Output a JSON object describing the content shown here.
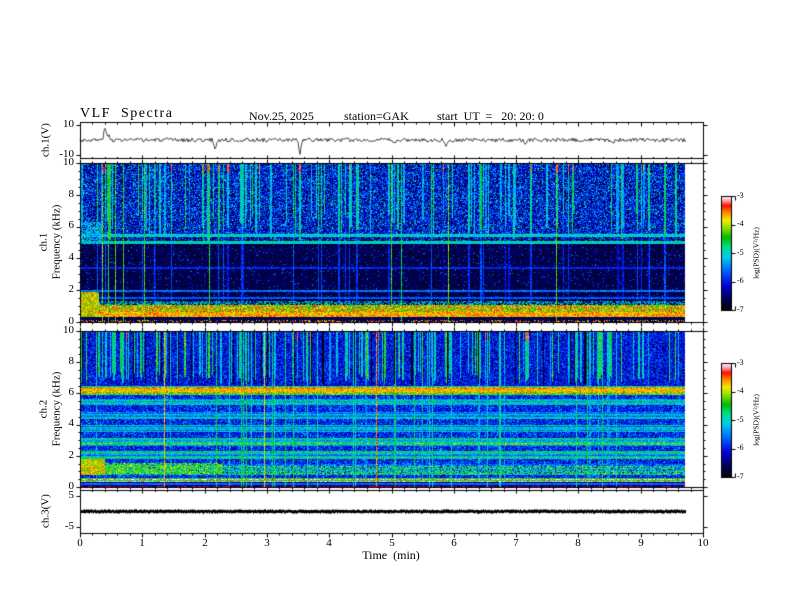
{
  "header": {
    "title": "VLF  Spectra",
    "date": "Nov.25, 2025",
    "station": "station=GAK",
    "start_ut": "start  UT  =   20: 20: 0"
  },
  "xaxis": {
    "label": "Time  (min)",
    "ticks": [
      "0",
      "1",
      "2",
      "3",
      "4",
      "5",
      "6",
      "7",
      "8",
      "9",
      "10"
    ],
    "range": [
      0,
      10
    ],
    "minor_step_min": 0.2,
    "data_end_min": 9.7
  },
  "colorbars": [
    {
      "label": "log(PSD)(V²/Hz)",
      "ticks": [
        "-3",
        "-4",
        "-5",
        "-6",
        "-7"
      ]
    },
    {
      "label": "log(PSD)(V²/Hz)",
      "ticks": [
        "-3",
        "-4",
        "-5",
        "-6",
        "-7"
      ]
    }
  ],
  "chart_data": {
    "colormap": {
      "range": [
        -7,
        -3
      ],
      "stops": [
        {
          "p": 0.0,
          "c": "#000000"
        },
        {
          "p": 0.1,
          "c": "#000055"
        },
        {
          "p": 0.22,
          "c": "#0000dd"
        },
        {
          "p": 0.35,
          "c": "#0066ff"
        },
        {
          "p": 0.47,
          "c": "#00ccee"
        },
        {
          "p": 0.56,
          "c": "#00dd88"
        },
        {
          "p": 0.64,
          "c": "#00bb00"
        },
        {
          "p": 0.72,
          "c": "#88dd00"
        },
        {
          "p": 0.79,
          "c": "#eeee00"
        },
        {
          "p": 0.86,
          "c": "#ff8800"
        },
        {
          "p": 0.92,
          "c": "#ff1100"
        },
        {
          "p": 0.96,
          "c": "#ff99aa"
        },
        {
          "p": 1.0,
          "c": "#ffffff"
        }
      ]
    },
    "panels": [
      {
        "type": "line",
        "name": "ch1-voltage",
        "ylabel": "ch.1(V)",
        "ytick_labels": [
          "10",
          "-10"
        ],
        "yticks_v": [
          10,
          -10
        ],
        "ylim": [
          -12,
          12
        ],
        "seed": 3,
        "noise_v": 1.3,
        "spikes": [
          {
            "t": 0.4,
            "v": 8.5
          },
          {
            "t": 0.46,
            "v": 3.5
          },
          {
            "t": 2.17,
            "v": -6.5
          },
          {
            "t": 3.53,
            "v": -9.5
          },
          {
            "t": 5.05,
            "v": -3.0
          },
          {
            "t": 5.88,
            "v": -4.0
          },
          {
            "t": 7.15,
            "v": -3.2
          },
          {
            "t": 8.55,
            "v": -2.5
          }
        ]
      },
      {
        "type": "heatmap",
        "name": "ch1-spectrogram",
        "ylabel_channel": "ch.1",
        "ylabel_axis": "Frequency  (kHz)",
        "ytick_labels": [
          "10",
          "8",
          "6",
          "4",
          "2",
          "0"
        ],
        "yticks_khz": [
          10,
          8,
          6,
          4,
          2,
          0
        ],
        "ylim_khz": [
          0,
          10
        ],
        "seed": 7,
        "features": [
          {
            "type": "fill",
            "v": 0.03,
            "a": 0.1
          },
          {
            "type": "band",
            "f0": 5.55,
            "f1": 10,
            "v": 0.06,
            "a": 0.3,
            "p": 0.9
          },
          {
            "type": "band",
            "f0": 5.55,
            "f1": 10,
            "v": 0.3,
            "a": 0.25,
            "p": 0.22
          },
          {
            "type": "band",
            "f0": 1.2,
            "f1": 5.55,
            "v": 0.02,
            "a": 0.13,
            "p": 0.85
          },
          {
            "type": "band",
            "f0": 1.2,
            "f1": 5.55,
            "v": 0.22,
            "a": 0.18,
            "p": 0.05
          },
          {
            "type": "band",
            "f0": 4.9,
            "f1": 5.6,
            "v": 0.2,
            "a": 0.25,
            "p": 0.45
          },
          {
            "type": "hline",
            "f": 5.45,
            "th": 2,
            "v": 0.42,
            "a": 0.15,
            "max": 1
          },
          {
            "type": "hline",
            "f": 5.05,
            "th": 2,
            "v": 0.45,
            "a": 0.15,
            "max": 1
          },
          {
            "type": "hline",
            "f": 2.0,
            "th": 1,
            "v": 0.3,
            "a": 0.12,
            "max": 1
          },
          {
            "type": "hline",
            "f": 3.4,
            "th": 1,
            "v": 0.22,
            "a": 0.1,
            "max": 1
          },
          {
            "type": "hline",
            "f": 1.55,
            "th": 1,
            "v": 0.28,
            "a": 0.1,
            "max": 1
          },
          {
            "type": "streaks",
            "count": 115,
            "d0": 5.0,
            "d1": 6.8,
            "pfull": 0.3,
            "v": 0.38,
            "a": 0.22,
            "phot": 0.1,
            "fullscale": 0.55
          },
          {
            "type": "band",
            "f0": 0.6,
            "f1": 1.05,
            "v": 0.6,
            "a": 0.35
          },
          {
            "type": "band",
            "f0": 0.33,
            "f1": 0.6,
            "v": 0.75,
            "a": 0.17
          },
          {
            "type": "band",
            "f0": 1.05,
            "f1": 1.35,
            "v": 0.3,
            "a": 0.35,
            "p": 0.6
          },
          {
            "type": "band",
            "f0": 0.0,
            "f1": 0.33,
            "v": 0.04,
            "a": 0.1
          },
          {
            "type": "band",
            "f0": 0.0,
            "f1": 0.12,
            "v": 0.75,
            "a": 0.2,
            "p": 0.3
          },
          {
            "type": "patch",
            "t0": 0,
            "t1": 0.3,
            "f0": 0.3,
            "f1": 1.9,
            "v": 0.65,
            "a": 0.25
          },
          {
            "type": "patch",
            "t0": 0,
            "t1": 0.35,
            "f0": 4.9,
            "f1": 6.3,
            "v": 0.35,
            "a": 0.2,
            "p": 0.7
          },
          {
            "type": "vlines",
            "count": 10,
            "v": 0.55,
            "a": 0.15
          }
        ]
      },
      {
        "type": "heatmap",
        "name": "ch2-spectrogram",
        "ylabel_channel": "ch.2",
        "ylabel_axis": "Frequency  (kHz)",
        "ytick_labels": [
          "10",
          "8",
          "6",
          "4",
          "2",
          "0"
        ],
        "yticks_khz": [
          10,
          8,
          6,
          4,
          2,
          0
        ],
        "ylim_khz": [
          0,
          10
        ],
        "seed": 13,
        "features": [
          {
            "type": "fill",
            "v": 0.14,
            "a": 0.2
          },
          {
            "type": "band",
            "f0": 6.6,
            "f1": 10,
            "v": 0.1,
            "a": 0.28,
            "p": 0.9
          },
          {
            "type": "band",
            "f0": 0.3,
            "f1": 6.0,
            "v": 0.28,
            "a": 0.2,
            "p": 0.25
          },
          {
            "type": "streaks",
            "count": 140,
            "d0": 6.6,
            "d1": 7.4,
            "pfull": 0.12,
            "v": 0.4,
            "a": 0.25,
            "phot": 0.04,
            "fullscale": 0.8
          },
          {
            "type": "darkcols",
            "count": 30,
            "f0": 6.6,
            "f1": 10,
            "v": 0.02,
            "a": 0.06
          },
          {
            "type": "band",
            "f0": 5.9,
            "f1": 6.5,
            "v": 0.5,
            "a": 0.28,
            "rm": 1
          },
          {
            "type": "hline",
            "f": 6.22,
            "th": 3,
            "v": 0.72,
            "a": 0.18,
            "max": 1
          },
          {
            "type": "band",
            "f0": 5.25,
            "f1": 5.65,
            "v": 0.38,
            "a": 0.25,
            "rm": 1
          },
          {
            "type": "band",
            "f0": 4.35,
            "f1": 4.8,
            "v": 0.36,
            "a": 0.22,
            "rm": 1
          },
          {
            "type": "band",
            "f0": 3.5,
            "f1": 4.0,
            "v": 0.33,
            "a": 0.22,
            "rm": 1
          },
          {
            "type": "band",
            "f0": 2.6,
            "f1": 3.15,
            "v": 0.42,
            "a": 0.26,
            "rm": 1
          },
          {
            "type": "band",
            "f0": 1.8,
            "f1": 2.3,
            "v": 0.36,
            "a": 0.22,
            "rm": 1
          },
          {
            "type": "band",
            "f0": 0.8,
            "f1": 1.5,
            "v": 0.35,
            "a": 0.3,
            "p": 0.8,
            "rm": 1
          },
          {
            "type": "patch",
            "t0": 0,
            "t1": 2.3,
            "f0": 0.85,
            "f1": 1.55,
            "v": 0.5,
            "a": 0.3,
            "p": 0.8
          },
          {
            "type": "patch",
            "t0": 0,
            "t1": 0.4,
            "f0": 0.8,
            "f1": 1.8,
            "v": 0.65,
            "a": 0.25
          },
          {
            "type": "band",
            "f0": 0.35,
            "f1": 0.58,
            "v": 0.55,
            "a": 0.3,
            "rm": 1
          },
          {
            "type": "band",
            "f0": 0.0,
            "f1": 0.3,
            "v": 0.07,
            "a": 0.12
          },
          {
            "type": "hline",
            "f": 0.22,
            "th": 1,
            "v": 0.3,
            "a": 0.1,
            "max": 1
          },
          {
            "type": "vline",
            "t": 1.35,
            "v": 0.75,
            "a": 0.15
          },
          {
            "type": "vline",
            "t": 2.95,
            "v": 0.7,
            "a": 0.15
          },
          {
            "type": "vline",
            "t": 4.75,
            "v": 0.78,
            "a": 0.15
          },
          {
            "type": "vlines",
            "count": 26,
            "v": 0.45,
            "a": 0.15
          },
          {
            "type": "dots_rgb",
            "f0": 0.0,
            "f1": 0.07,
            "p": 0.45,
            "color": "#cc0055"
          }
        ]
      },
      {
        "type": "line",
        "name": "ch3-voltage",
        "ylabel": "ch.3(V)",
        "ytick_labels": [
          "5",
          "-5"
        ],
        "yticks_v": [
          5,
          -5
        ],
        "ylim": [
          -7,
          7
        ],
        "seed": 5,
        "level_v": 0,
        "noise_v": 0.35,
        "thickness_px": 2.6
      }
    ]
  }
}
